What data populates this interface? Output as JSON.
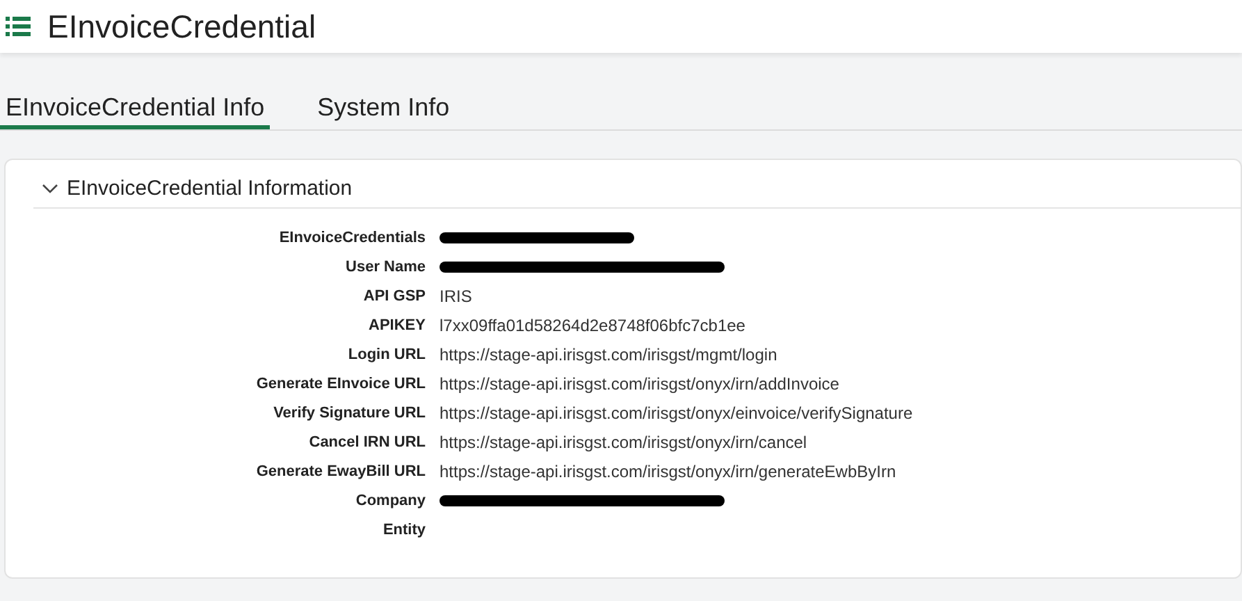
{
  "header": {
    "title": "EInvoiceCredential"
  },
  "tabs": [
    {
      "label": "EInvoiceCredential Info",
      "selected": true
    },
    {
      "label": "System Info",
      "selected": false
    }
  ],
  "section": {
    "title": "EInvoiceCredential Information",
    "expanded": true,
    "fields": [
      {
        "label": "EInvoiceCredentials",
        "kind": "redacted"
      },
      {
        "label": "User Name",
        "kind": "redacted"
      },
      {
        "label": "API GSP",
        "kind": "text",
        "value": "IRIS"
      },
      {
        "label": "APIKEY",
        "kind": "text",
        "value": "l7xx09ffa01d58264d2e8748f06bfc7cb1ee"
      },
      {
        "label": "Login URL",
        "kind": "text",
        "value": "https://stage-api.irisgst.com/irisgst/mgmt/login"
      },
      {
        "label": "Generate EInvoice URL",
        "kind": "text",
        "value": "https://stage-api.irisgst.com/irisgst/onyx/irn/addInvoice"
      },
      {
        "label": "Verify Signature URL",
        "kind": "text",
        "value": "https://stage-api.irisgst.com/irisgst/onyx/einvoice/verifySignature"
      },
      {
        "label": "Cancel IRN URL",
        "kind": "text",
        "value": "https://stage-api.irisgst.com/irisgst/onyx/irn/cancel"
      },
      {
        "label": "Generate EwayBill URL",
        "kind": "text",
        "value": "https://stage-api.irisgst.com/irisgst/onyx/irn/generateEwbByIrn"
      },
      {
        "label": "Company",
        "kind": "redacted"
      },
      {
        "label": "Entity",
        "kind": "empty"
      }
    ]
  }
}
